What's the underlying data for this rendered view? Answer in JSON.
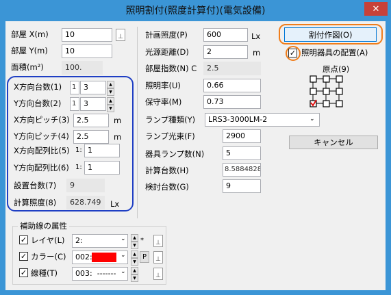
{
  "window": {
    "title": "照明割付(照度計算付)(電気設備)",
    "close": "✕"
  },
  "left": {
    "room_x": {
      "label": "部屋 X(m)",
      "value": "10"
    },
    "room_y": {
      "label": "部屋 Y(m)",
      "value": "10"
    },
    "area": {
      "label": "面積(m²)",
      "value": "100."
    },
    "x_count": {
      "label": "X方向台数(1)",
      "prefix": "1",
      "value": "3"
    },
    "y_count": {
      "label": "Y方向台数(2)",
      "prefix": "1",
      "value": "3"
    },
    "x_pitch": {
      "label": "X方向ピッチ(3)",
      "value": "2.5",
      "unit": "m"
    },
    "y_pitch": {
      "label": "Y方向ピッチ(4)",
      "value": "2.5",
      "unit": "m"
    },
    "x_ratio": {
      "label": "X方向配列比(5)",
      "prefix": "1:",
      "value": "1"
    },
    "y_ratio": {
      "label": "Y方向配列比(6)",
      "prefix": "1:",
      "value": "1"
    },
    "install_count": {
      "label": "設置台数(7)",
      "value": "9"
    },
    "calc_lux": {
      "label": "計算照度(8)",
      "value": "628.749",
      "unit": "Lx"
    }
  },
  "mid": {
    "plan_lux": {
      "label": "計画照度(P)",
      "value": "600",
      "unit": "Lx"
    },
    "source_dist": {
      "label": "光源距離(D)",
      "value": "2",
      "unit": "m"
    },
    "room_index": {
      "label": "部屋指数(N) C",
      "value": "2.5"
    },
    "reflect": {
      "label": "照明率(U)",
      "value": "0.66"
    },
    "maint": {
      "label": "保守率(M)",
      "value": "0.73"
    },
    "lamp_type": {
      "label": "ランプ種類(Y)",
      "value": "LRS3-3000LM-2"
    },
    "lamp_flux": {
      "label": "ランプ光束(F)",
      "value": "2900"
    },
    "lamps_per": {
      "label": "器具ランプ数(N)",
      "value": "5"
    },
    "calc_count": {
      "label": "計算台数(H)",
      "value": "8.5884828"
    },
    "check_count": {
      "label": "検討台数(G)",
      "value": "9"
    }
  },
  "right": {
    "layout_button": "割付作図(O)",
    "place_fixtures": {
      "label": "照明器具の配置(A)",
      "checked": "✓"
    },
    "origin": {
      "label": "原点(9)"
    },
    "cancel_button": "キャンセル"
  },
  "aux": {
    "group_title": "補助線の属性",
    "layer": {
      "label": "レイヤ(L)",
      "value": "2:",
      "extra": "*"
    },
    "color": {
      "label": "カラー(C)",
      "value": "002:",
      "extra": "P",
      "swatch": "#ff0000"
    },
    "linetype": {
      "label": "線種(T)",
      "value": "003:  -------"
    }
  },
  "colors": {
    "highlight_orange": "#f07d1a",
    "highlight_blue": "#1f3fc4",
    "titlebar": "#3b95d6"
  }
}
